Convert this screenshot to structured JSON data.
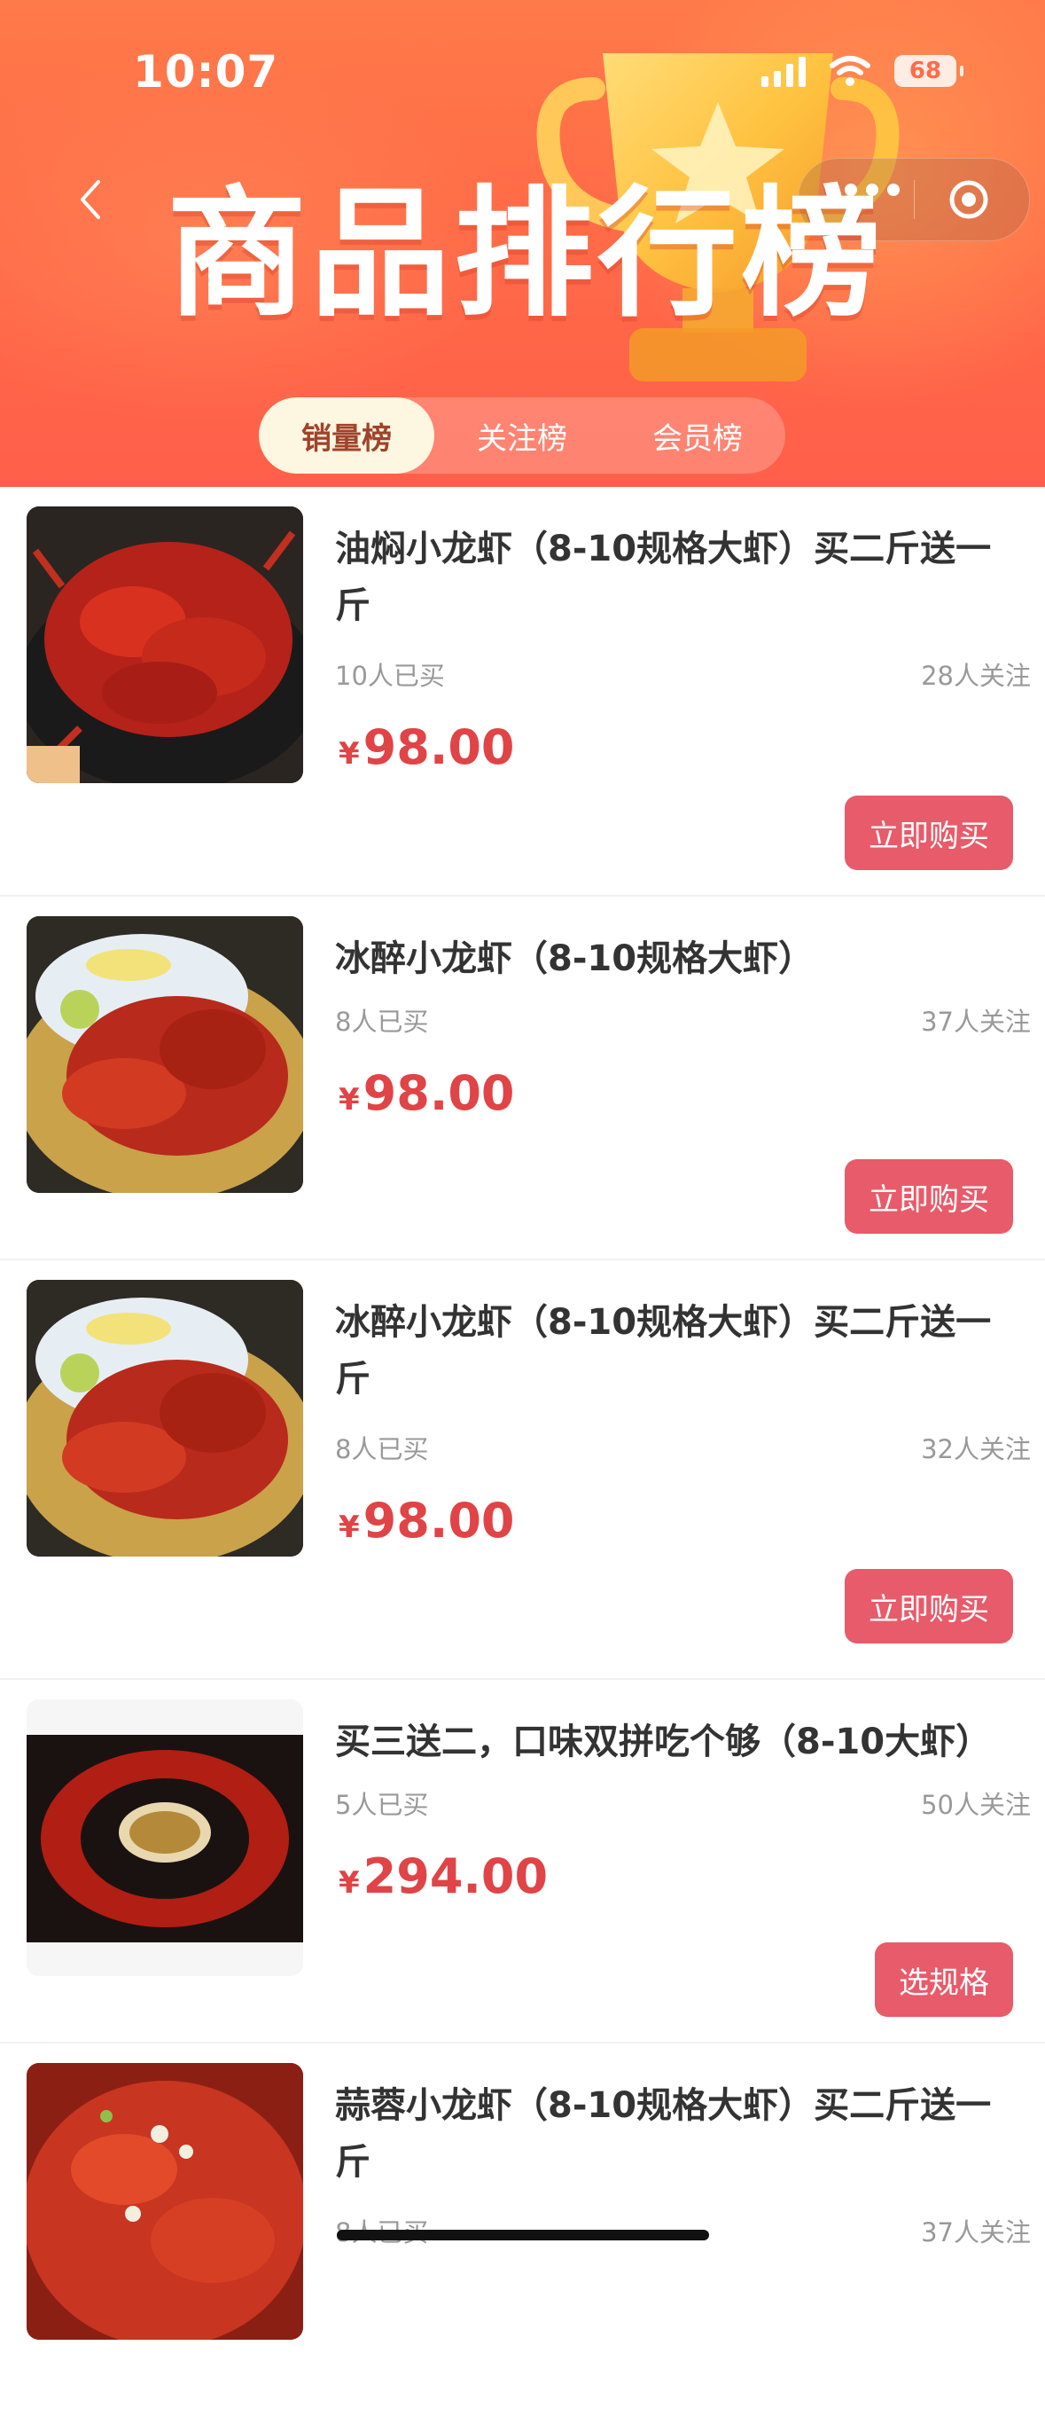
{
  "status": {
    "time": "10:07",
    "battery": "68"
  },
  "header": {
    "title": "商品排行榜"
  },
  "tabs": [
    {
      "label": "销量榜",
      "active": true
    },
    {
      "label": "关注榜",
      "active": false
    },
    {
      "label": "会员榜",
      "active": false
    }
  ],
  "products": [
    {
      "title": "油焖小龙虾（8-10规格大虾）买二斤送一斤",
      "bought": "10人已买",
      "follow": "28人关注",
      "currency": "¥",
      "price": "98.00",
      "button": "立即购买"
    },
    {
      "title": "冰醉小龙虾（8-10规格大虾）",
      "bought": "8人已买",
      "follow": "37人关注",
      "currency": "¥",
      "price": "98.00",
      "button": "立即购买"
    },
    {
      "title": "冰醉小龙虾（8-10规格大虾）买二斤送一斤",
      "bought": "8人已买",
      "follow": "32人关注",
      "currency": "¥",
      "price": "98.00",
      "button": "立即购买"
    },
    {
      "title": "买三送二，口味双拼吃个够（8-10大虾）",
      "bought": "5人已买",
      "follow": "50人关注",
      "currency": "¥",
      "price": "294.00",
      "button": "选规格"
    },
    {
      "title": "蒜蓉小龙虾（8-10规格大虾）买二斤送一斤",
      "bought": "8人已买",
      "follow": "37人关注"
    }
  ],
  "colors": {
    "accent": "#e85b6a",
    "price": "#e04446",
    "header": "#ff6b47"
  }
}
